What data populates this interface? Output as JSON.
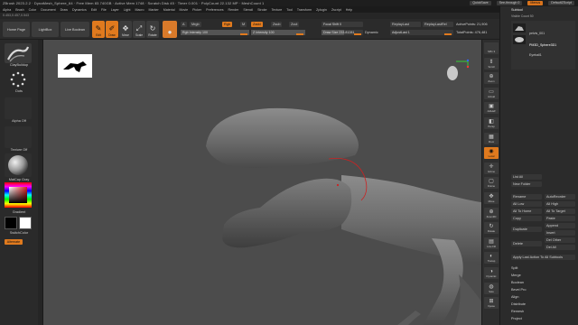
{
  "titlebar": {
    "text": "ZBrush 2023.2.2 · DynaMesh_Sphere_64 · Free Mem 83.740GB · Active Mem 1748 · Scratch Disk 45 · Timer 0.001 · PolyCount 22.132 MP · MeshCount 1",
    "quicksave": "QuickSave",
    "seethrough": "See-through 0",
    "menus": "Menus",
    "script": "DefaultZScript"
  },
  "menubar": [
    "Alpha",
    "Brush",
    "Color",
    "Document",
    "Draw",
    "Dynamics",
    "Edit",
    "File",
    "Layer",
    "Light",
    "Macro",
    "Marker",
    "Material",
    "Movie",
    "Picker",
    "Preferences",
    "Render",
    "Stencil",
    "Stroke",
    "Texture",
    "Tool",
    "Transform",
    "Zplugin",
    "Zscript",
    "Help"
  ],
  "coords": "0.453,0.457,0.543",
  "toolbar": {
    "home": "Home Page",
    "lightbox": "LightBox",
    "boolean": "Live Boolean",
    "tools": [
      {
        "label": "Edit",
        "glyph": "✎",
        "on": true
      },
      {
        "label": "Draw",
        "glyph": "✐",
        "on": true
      },
      {
        "label": "Move",
        "glyph": "✥",
        "on": false
      },
      {
        "label": "Scale",
        "glyph": "⤢",
        "on": false
      },
      {
        "label": "Rotate",
        "glyph": "↻",
        "on": false
      }
    ],
    "a": "A",
    "mrgb": "Mrgb",
    "rgb": "Rgb",
    "m": "M",
    "zadd": "Zadd",
    "zsub": "Zsub",
    "zcut": "Zcut",
    "rgb_intensity": "Rgb Intensity 100",
    "z_intensity": "Z Intensity 100",
    "focal_shift": "Focal Shift 0",
    "draw_size": "Draw Size 233.81281",
    "dynamic": "Dynamic",
    "replay_last": "ReplayLast",
    "replay_last_rel": "ReplayLastRel",
    "adjust_last": "AdjustLast 1",
    "active_points": "ActivePoints: 21,906",
    "total_points": "TotalPoints: 476,481"
  },
  "left": {
    "brush": "ClayBuildup",
    "stroke": "Dots",
    "alpha": "Alpha Off",
    "texture": "Texture Off",
    "material": "MatCap Gray",
    "gradient": "Gradient",
    "switch": "SwitchColor",
    "alternate": "Alternate"
  },
  "rightstrip": [
    {
      "label": "SPix 3",
      "glyph": "",
      "on": false
    },
    {
      "label": "Scroll",
      "glyph": "⇕",
      "on": false
    },
    {
      "label": "Zoom",
      "glyph": "⊕",
      "on": false
    },
    {
      "label": "Actual",
      "glyph": "▭",
      "on": false
    },
    {
      "label": "AAHalf",
      "glyph": "▣",
      "on": false
    },
    {
      "label": "Persp",
      "glyph": "◧",
      "on": false
    },
    {
      "label": "Floor",
      "glyph": "▦",
      "on": false
    },
    {
      "label": "Local",
      "glyph": "◉",
      "on": true
    },
    {
      "label": "Gizmo",
      "glyph": "✛",
      "on": false
    },
    {
      "label": "Frame",
      "glyph": "▢",
      "on": false
    },
    {
      "label": "Move",
      "glyph": "✥",
      "on": false
    },
    {
      "label": "Zoom3D",
      "glyph": "⊕",
      "on": false
    },
    {
      "label": "Rotate",
      "glyph": "↻",
      "on": false
    },
    {
      "label": "Line Fill",
      "glyph": "▤",
      "on": false
    },
    {
      "label": "Transp",
      "glyph": "◐",
      "on": false
    },
    {
      "label": "Dynamic",
      "glyph": "◑",
      "on": false
    },
    {
      "label": "Solo",
      "glyph": "◍",
      "on": false
    },
    {
      "label": "Xpose",
      "glyph": "⊞",
      "on": false
    }
  ],
  "subtool": {
    "header": "Subtool",
    "visible": "Visible Count 50",
    "items": [
      "pelvis_001",
      "PM3D_Sphere3D1",
      "Eyeball1"
    ],
    "list_all": "List All",
    "new_folder": "New Folder",
    "buttons": [
      [
        "Rename",
        "AutoReorder"
      ],
      [
        "All Low",
        "All High"
      ],
      [
        "All To Home",
        "All To Target"
      ],
      [
        "Copy",
        "Paste"
      ],
      [
        "Duplicate",
        "Append"
      ],
      [
        "",
        "Insert"
      ],
      [
        "Delete",
        "Del Other"
      ],
      [
        "",
        "Del All"
      ]
    ],
    "apply": "Apply Last Action To All Subtools",
    "sections": [
      "Split",
      "Merge",
      "Boolean",
      "Bevel Pro",
      "Align",
      "Distribute",
      "Remesh",
      "Project"
    ]
  },
  "colors": {
    "accent": "#e07a1e",
    "canvas": "#4c4c4c",
    "panel": "#2b2b2b"
  }
}
